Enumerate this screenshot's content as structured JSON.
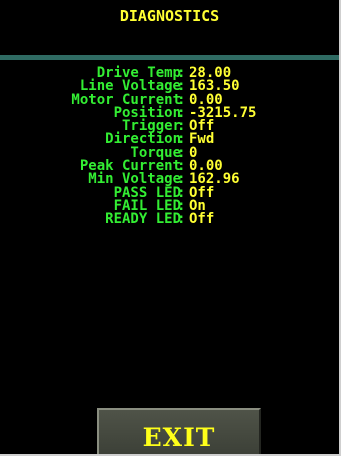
{
  "header": {
    "title": "DIAGNOSTICS"
  },
  "diagnostics": [
    {
      "label": "Drive Temp",
      "value": "28.00"
    },
    {
      "label": "Line Voltage",
      "value": "163.50"
    },
    {
      "label": "Motor Current",
      "value": "0.00"
    },
    {
      "label": "Position",
      "value": "-3215.75"
    },
    {
      "label": "Trigger",
      "value": "Off"
    },
    {
      "label": "Direction",
      "value": "Fwd"
    },
    {
      "label": "Torque",
      "value": "0"
    },
    {
      "label": "Peak Current",
      "value": "0.00"
    },
    {
      "label": "Min Voltage",
      "value": "162.96"
    },
    {
      "label": "PASS LED",
      "value": "Off"
    },
    {
      "label": "FAIL LED",
      "value": "On"
    },
    {
      "label": "READY LED",
      "value": "Off"
    }
  ],
  "footer": {
    "exit_label": "EXIT"
  },
  "colors": {
    "background": "#000000",
    "title": "#ffff33",
    "label": "#33ee33",
    "value": "#ffff33",
    "divider": "#2f6b63",
    "button": "#44483e"
  }
}
